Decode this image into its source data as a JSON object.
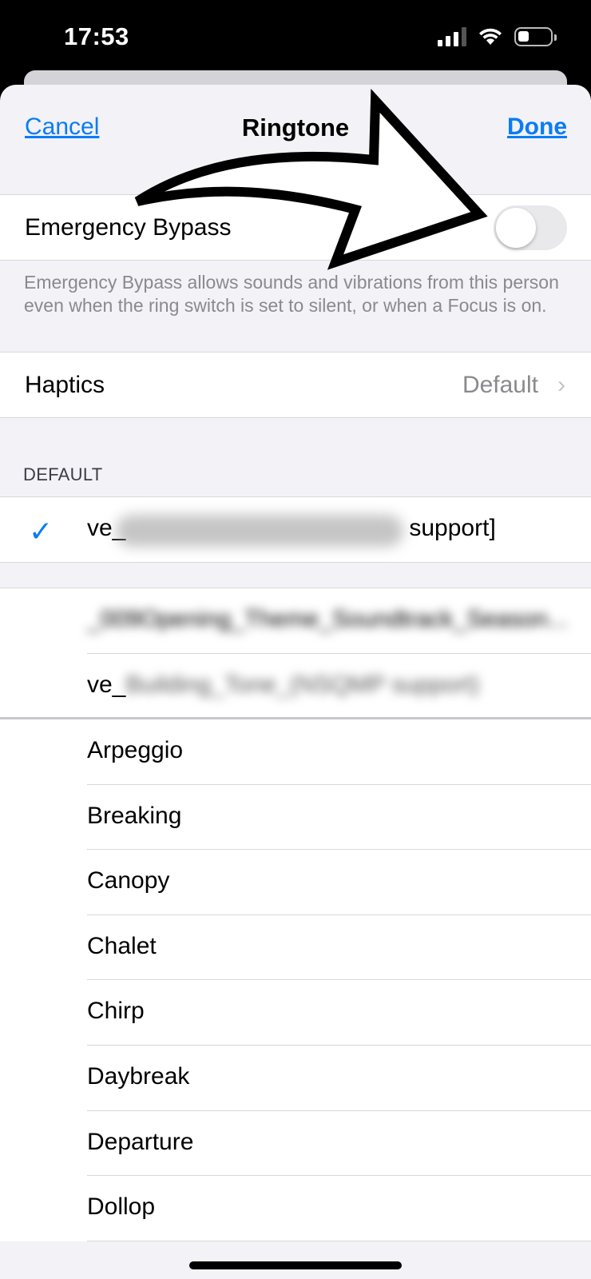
{
  "status_bar": {
    "time": "17:53"
  },
  "nav": {
    "cancel": "Cancel",
    "title": "Ringtone",
    "done": "Done"
  },
  "emergency": {
    "label": "Emergency Bypass",
    "enabled": false,
    "footer": "Emergency Bypass allows sounds and vibrations from this person even when the ring switch is set to silent, or when a Focus is on."
  },
  "haptics": {
    "label": "Haptics",
    "value": "Default"
  },
  "default_section": {
    "header": "DEFAULT",
    "selected": {
      "prefix": "ve_",
      "suffix": "support]",
      "checkmark": "✓"
    }
  },
  "custom_tones": [
    {
      "text": "_009Opening_Theme_Soundtrack_Season..."
    },
    {
      "prefix": "ve_",
      "rest": "Building_Tone_(NSQMP support)"
    }
  ],
  "ringtones": [
    "Arpeggio",
    "Breaking",
    "Canopy",
    "Chalet",
    "Chirp",
    "Daybreak",
    "Departure",
    "Dollop"
  ],
  "colors": {
    "accent": "#0a7cf5",
    "background": "#f2f2f7"
  }
}
